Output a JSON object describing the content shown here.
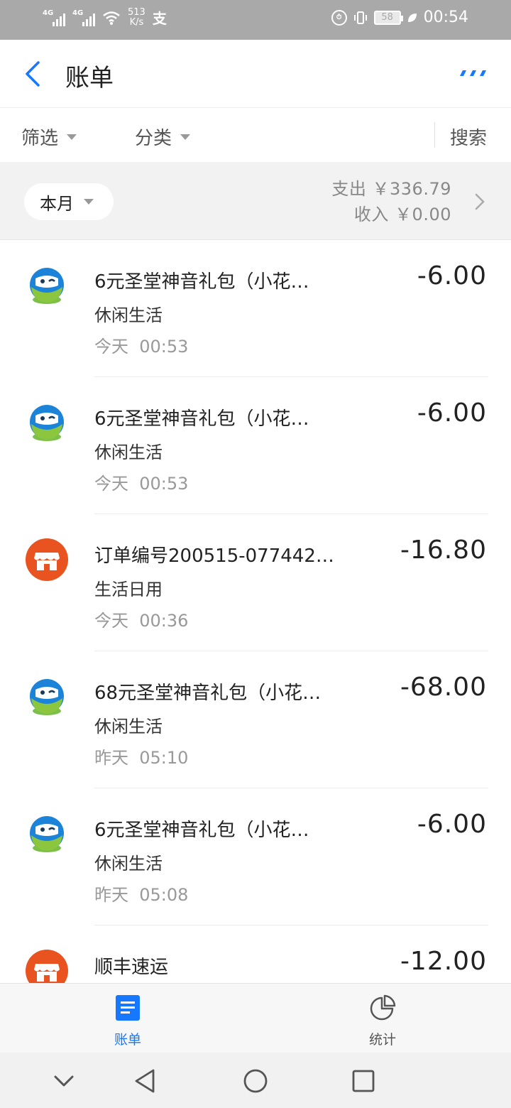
{
  "status_bar": {
    "network_left": "4G",
    "network_right": "4G",
    "speed_value": "513",
    "speed_unit": "K/s",
    "alipay_glyph": "支",
    "battery": "58",
    "time": "00:54"
  },
  "header": {
    "title": "账单",
    "back_icon": "chevron-left-icon",
    "more_icon": "more-dots-icon"
  },
  "filter_bar": {
    "filter_label": "筛选",
    "category_label": "分类",
    "search_label": "搜索"
  },
  "summary": {
    "month_label": "本月",
    "expense_label": "支出",
    "expense_value": "￥336.79",
    "income_label": "收入",
    "income_value": "￥0.00"
  },
  "transactions": [
    {
      "title": "6元圣堂神音礼包（小花…",
      "category": "休闲生活",
      "day": "今天",
      "time": "00:53",
      "amount": "-6.00",
      "icon": "game-mascot-icon"
    },
    {
      "title": "6元圣堂神音礼包（小花…",
      "category": "休闲生活",
      "day": "今天",
      "time": "00:53",
      "amount": "-6.00",
      "icon": "game-mascot-icon"
    },
    {
      "title": "订单编号200515-077442…",
      "category": "生活日用",
      "day": "今天",
      "time": "00:36",
      "amount": "-16.80",
      "icon": "store-icon"
    },
    {
      "title": "68元圣堂神音礼包（小花…",
      "category": "休闲生活",
      "day": "昨天",
      "time": "05:10",
      "amount": "-68.00",
      "icon": "game-mascot-icon"
    },
    {
      "title": "6元圣堂神音礼包（小花…",
      "category": "休闲生活",
      "day": "昨天",
      "time": "05:08",
      "amount": "-6.00",
      "icon": "game-mascot-icon"
    },
    {
      "title": "顺丰速运",
      "category": "",
      "day": "",
      "time": "",
      "amount": "-12.00",
      "icon": "store-icon"
    }
  ],
  "tab_bar": {
    "bill_label": "账单",
    "stats_label": "统计"
  },
  "colors": {
    "accent": "#1677ff",
    "status_bar": "#a9a9a9",
    "store_orange": "#e8531f"
  }
}
